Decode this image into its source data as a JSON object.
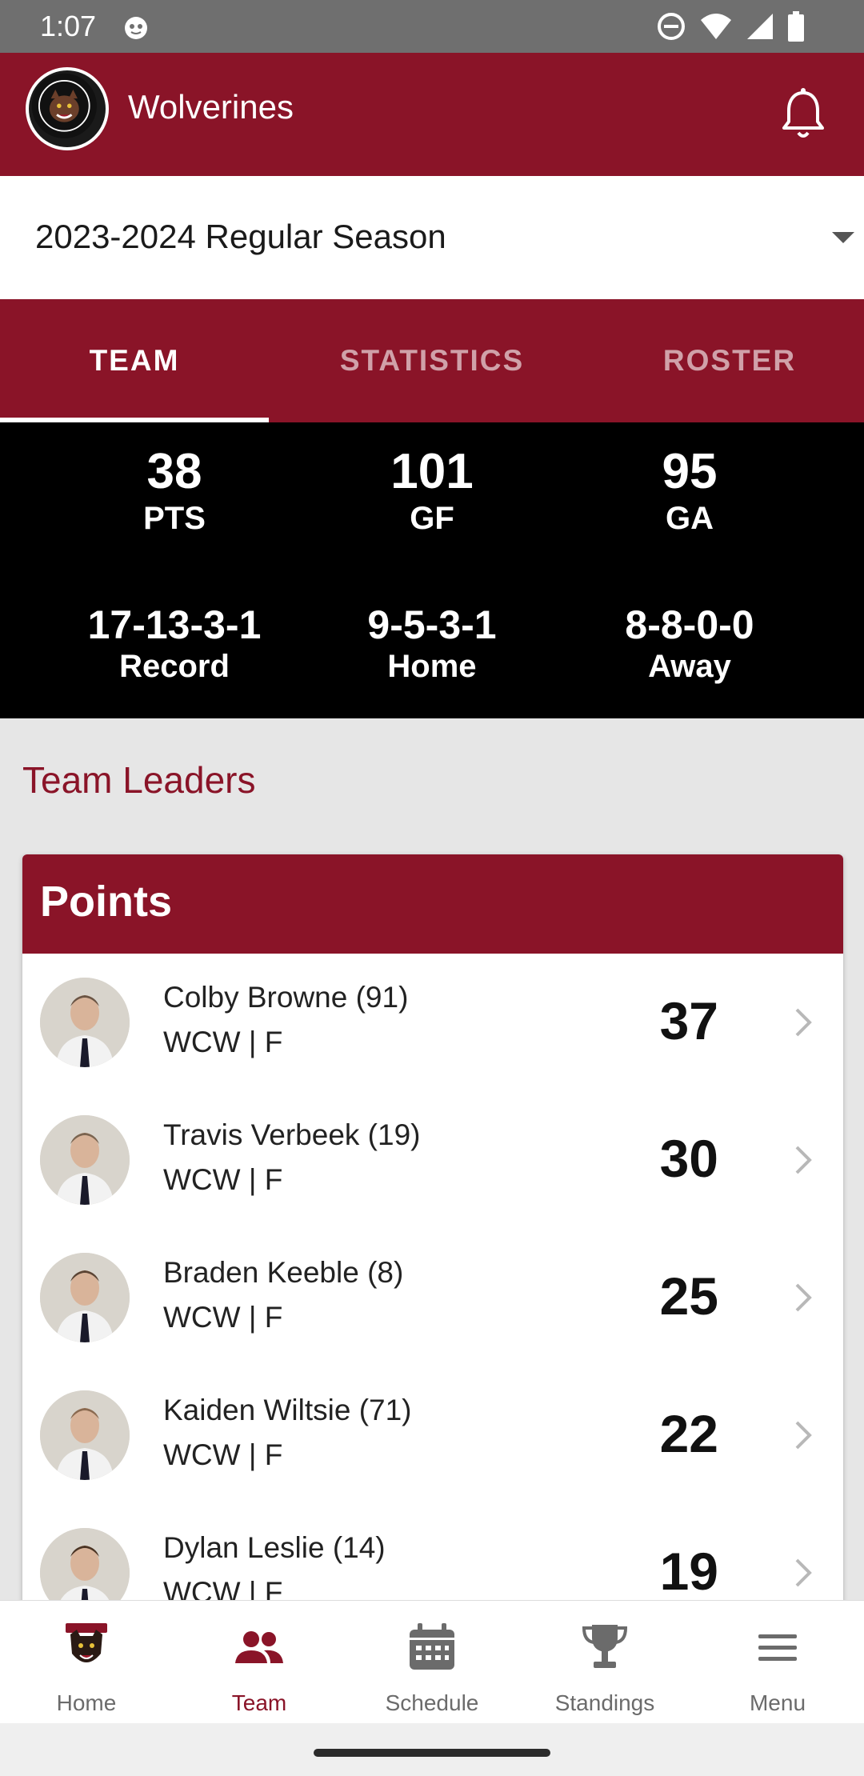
{
  "status_bar": {
    "time": "1:07"
  },
  "app_bar": {
    "title": "Wolverines"
  },
  "season": {
    "selected": "2023-2024 Regular Season"
  },
  "tabs": [
    {
      "label": "TEAM",
      "active": true
    },
    {
      "label": "STATISTICS",
      "active": false
    },
    {
      "label": "ROSTER",
      "active": false
    }
  ],
  "stats": {
    "pts": {
      "value": "38",
      "label": "PTS"
    },
    "gf": {
      "value": "101",
      "label": "GF"
    },
    "ga": {
      "value": "95",
      "label": "GA"
    },
    "record": {
      "value": "17-13-3-1",
      "label": "Record"
    },
    "home": {
      "value": "9-5-3-1",
      "label": "Home"
    },
    "away": {
      "value": "8-8-0-0",
      "label": "Away"
    }
  },
  "leaders": {
    "section_title": "Team Leaders",
    "card_title": "Points",
    "players": [
      {
        "name": "Colby Browne (91)",
        "sub": "WCW | F",
        "value": "37"
      },
      {
        "name": "Travis Verbeek (19)",
        "sub": "WCW | F",
        "value": "30"
      },
      {
        "name": "Braden Keeble (8)",
        "sub": "WCW | F",
        "value": "25"
      },
      {
        "name": "Kaiden Wiltsie (71)",
        "sub": "WCW | F",
        "value": "22"
      },
      {
        "name": "Dylan Leslie (14)",
        "sub": "WCW | F",
        "value": "19"
      }
    ]
  },
  "bottom_nav": [
    {
      "label": "Home",
      "icon": "team-logo-icon",
      "active": false
    },
    {
      "label": "Team",
      "icon": "people-icon",
      "active": true
    },
    {
      "label": "Schedule",
      "icon": "calendar-icon",
      "active": false
    },
    {
      "label": "Standings",
      "icon": "trophy-icon",
      "active": false
    },
    {
      "label": "Menu",
      "icon": "hamburger-menu-icon",
      "active": false
    }
  ],
  "colors": {
    "brand": "#8a1428",
    "stats_bg": "#000000",
    "page_bg": "#e6e6e6"
  }
}
